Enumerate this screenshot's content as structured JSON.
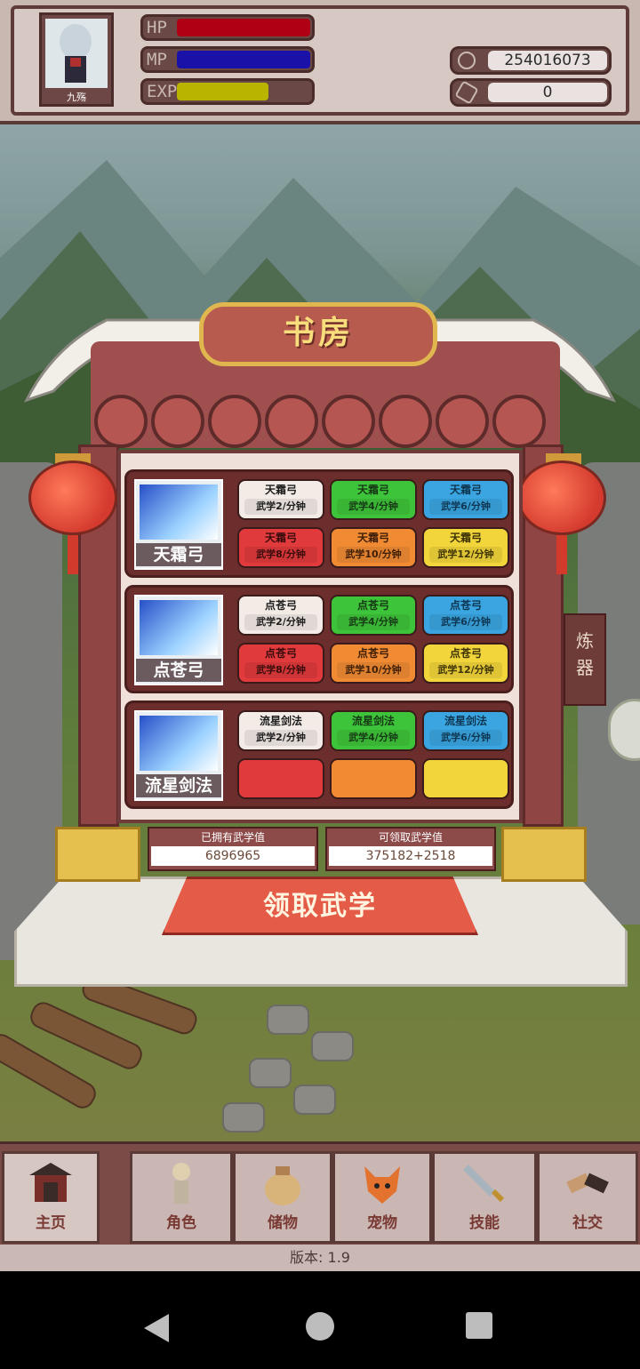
{
  "header": {
    "player_name": "九殇",
    "bars": [
      {
        "label": "HP",
        "fill_fraction": 1.0,
        "color": "#b00014"
      },
      {
        "label": "MP",
        "fill_fraction": 1.0,
        "color": "#1a12a8"
      },
      {
        "label": "EXP",
        "fill_fraction": 0.69,
        "color": "#b8b400"
      }
    ],
    "coins": "254016073",
    "gems": "0"
  },
  "study": {
    "title": "书房",
    "rows": [
      {
        "name": "天霜弓",
        "cells": [
          {
            "name": "天霜弓",
            "rate": "武学2/分钟",
            "tier": "white"
          },
          {
            "name": "天霜弓",
            "rate": "武学4/分钟",
            "tier": "green"
          },
          {
            "name": "天霜弓",
            "rate": "武学6/分钟",
            "tier": "blue"
          },
          {
            "name": "天霜弓",
            "rate": "武学8/分钟",
            "tier": "red"
          },
          {
            "name": "天霜弓",
            "rate": "武学10/分钟",
            "tier": "orange"
          },
          {
            "name": "天霜弓",
            "rate": "武学12/分钟",
            "tier": "yellow"
          }
        ]
      },
      {
        "name": "点苍弓",
        "cells": [
          {
            "name": "点苍弓",
            "rate": "武学2/分钟",
            "tier": "white"
          },
          {
            "name": "点苍弓",
            "rate": "武学4/分钟",
            "tier": "green"
          },
          {
            "name": "点苍弓",
            "rate": "武学6/分钟",
            "tier": "blue"
          },
          {
            "name": "点苍弓",
            "rate": "武学8/分钟",
            "tier": "red"
          },
          {
            "name": "点苍弓",
            "rate": "武学10/分钟",
            "tier": "orange"
          },
          {
            "name": "点苍弓",
            "rate": "武学12/分钟",
            "tier": "yellow"
          }
        ]
      },
      {
        "name": "流星剑法",
        "cells": [
          {
            "name": "流星剑法",
            "rate": "武学2/分钟",
            "tier": "white"
          },
          {
            "name": "流星剑法",
            "rate": "武学4/分钟",
            "tier": "green"
          },
          {
            "name": "流星剑法",
            "rate": "武学6/分钟",
            "tier": "blue"
          },
          {
            "name": "",
            "rate": "",
            "tier": "red"
          },
          {
            "name": "",
            "rate": "",
            "tier": "orange"
          },
          {
            "name": "",
            "rate": "",
            "tier": "yellow"
          }
        ]
      }
    ],
    "owned_label": "已拥有武学值",
    "owned_value": "6896965",
    "claimable_label": "可领取武学值",
    "claimable_value": "375182+2518",
    "claim_button": "领取武学",
    "side_tab": "炼器"
  },
  "nav": [
    {
      "label": "主页",
      "icon": "pavilion-icon",
      "active": true
    },
    {
      "label": "角色",
      "icon": "character-icon",
      "active": false
    },
    {
      "label": "储物",
      "icon": "bag-icon",
      "active": false
    },
    {
      "label": "宠物",
      "icon": "fox-icon",
      "active": false
    },
    {
      "label": "技能",
      "icon": "sword-icon",
      "active": false
    },
    {
      "label": "社交",
      "icon": "handshake-icon",
      "active": false
    }
  ],
  "version": "版本: 1.9"
}
